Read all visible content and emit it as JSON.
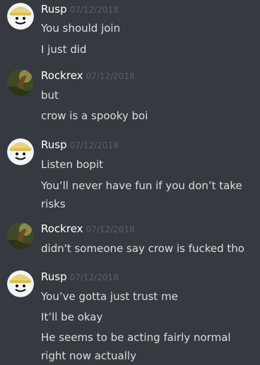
{
  "messages": [
    {
      "username": "Rusp",
      "timestamp": "07/12/2018",
      "avatar": "rusp-avatar",
      "lines": [
        "You should join",
        "I just did"
      ]
    },
    {
      "username": "Rockrex",
      "timestamp": "07/12/2018",
      "avatar": "rockrex-avatar",
      "lines": [
        "but",
        "crow is a spooky boi"
      ]
    },
    {
      "username": "Rusp",
      "timestamp": "07/12/2018",
      "avatar": "rusp-avatar",
      "lines": [
        "Listen bopit",
        "You’ll never have fun if you don’t take risks"
      ]
    },
    {
      "username": "Rockrex",
      "timestamp": "07/12/2018",
      "avatar": "rockrex-avatar",
      "lines": [
        "didn't someone say crow is fucked tho"
      ]
    },
    {
      "username": "Rusp",
      "timestamp": "07/12/2018",
      "avatar": "rusp-avatar",
      "lines": [
        "You’ve gotta just trust me",
        "It’ll be okay",
        "He seems to be acting fairly normal right now actually"
      ]
    }
  ],
  "colors": {
    "background": "#36393f",
    "username": "#ffffff",
    "timestamp": "#5c5f66",
    "message_text": "#dcddde"
  }
}
